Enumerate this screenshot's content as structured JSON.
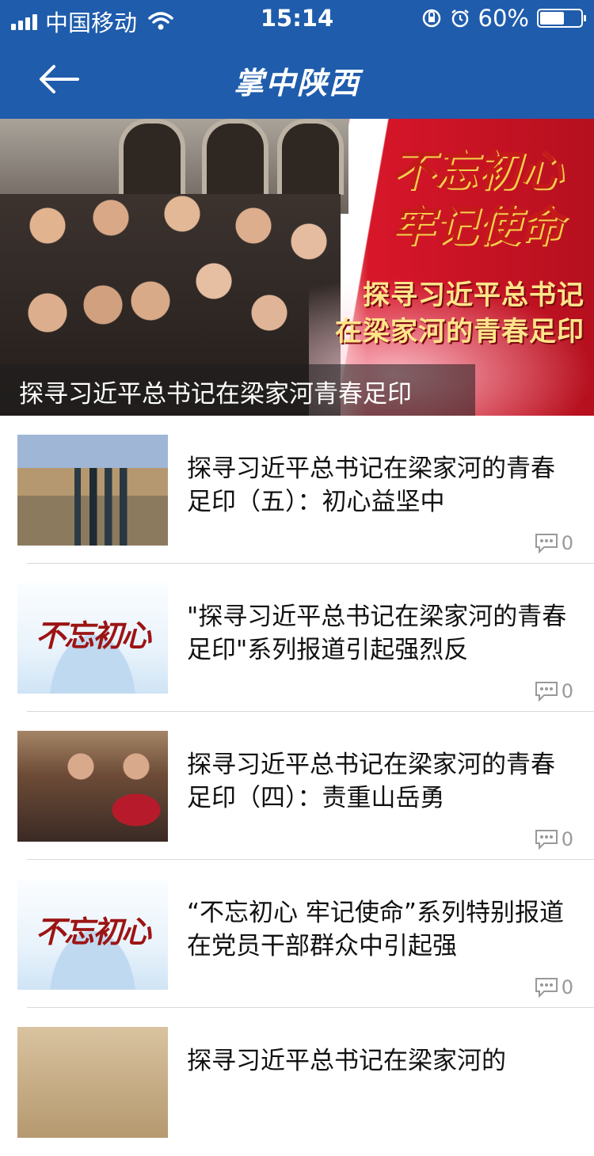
{
  "status_bar": {
    "carrier": "中国移动",
    "time": "15:14",
    "battery": "60%",
    "battery_level": 0.6
  },
  "nav": {
    "title": "掌中陕西",
    "back_icon": "arrow-left-icon"
  },
  "banner": {
    "calligraphy_line1": "不忘初心",
    "calligraphy_line2": "牢记使命",
    "headline_line1": "探寻习近平总书记",
    "headline_line2": "在梁家河的青春足印",
    "caption": "探寻习近平总书记在梁家河青春足印"
  },
  "articles": [
    {
      "title": "探寻习近平总书记在梁家河的青春足印（五）：初心益坚中",
      "comments": "0",
      "thumb": "photo"
    },
    {
      "title": "\"探寻习近平总书记在梁家河的青春足印\"系列报道引起强烈反",
      "comments": "0",
      "thumb": "calligraphy",
      "thumb_text": "不忘初心"
    },
    {
      "title": "探寻习近平总书记在梁家河的青春足印（四）：责重山岳勇",
      "comments": "0",
      "thumb": "photo"
    },
    {
      "title": "“不忘初心 牢记使命”系列特别报道在党员干部群众中引起强",
      "comments": "0",
      "thumb": "calligraphy",
      "thumb_text": "不忘初心"
    },
    {
      "title": "探寻习近平总书记在梁家河的",
      "comments": "",
      "thumb": "photo"
    }
  ],
  "colors": {
    "nav_blue": "#1f5cac",
    "banner_red": "#c8141f"
  }
}
